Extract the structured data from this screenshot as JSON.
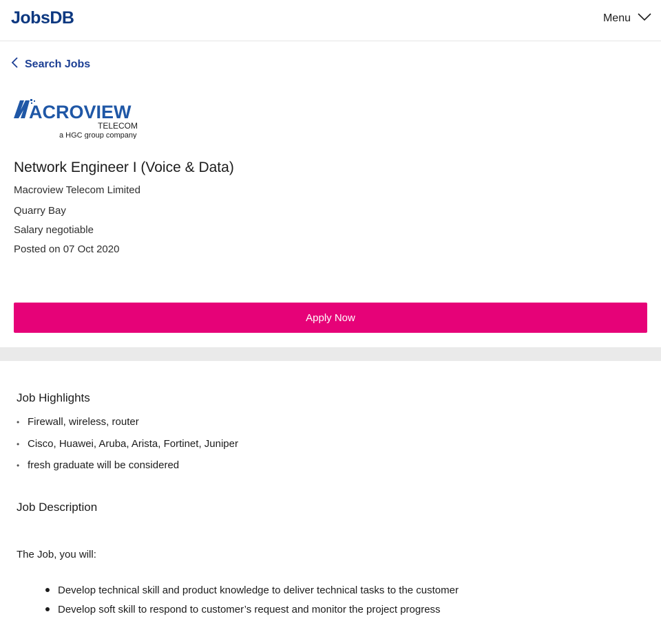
{
  "header": {
    "logo_text": "JobsDB",
    "menu_label": "Menu",
    "menu_icon": "chevron-down-icon"
  },
  "nav": {
    "back_label": "Search Jobs",
    "back_icon": "chevron-left-icon"
  },
  "job": {
    "company_logo": {
      "brand": "ACROVIEW",
      "subline": "TELECOM",
      "tagline": "a HGC group company"
    },
    "title": "Network Engineer I (Voice & Data)",
    "company": "Macroview Telecom Limited",
    "location": "Quarry Bay",
    "salary": "Salary negotiable",
    "posted": "Posted on 07 Oct 2020",
    "apply_label": "Apply Now"
  },
  "highlights": {
    "title": "Job Highlights",
    "items": [
      "Firewall, wireless, router",
      "Cisco, Huawei, Aruba, Arista, Fortinet, Juniper",
      "fresh graduate will be considered"
    ]
  },
  "description": {
    "title": "Job Description",
    "intro": "The Job, you will:",
    "items": [
      "Develop technical skill and product knowledge to deliver technical tasks to the customer",
      "Develop soft skill to respond to customer’s request and monitor the project progress"
    ]
  },
  "colors": {
    "brand_blue": "#0d3880",
    "link_blue": "#1c3f94",
    "apply_pink": "#e60278",
    "divider_gray": "#eaeaea"
  }
}
